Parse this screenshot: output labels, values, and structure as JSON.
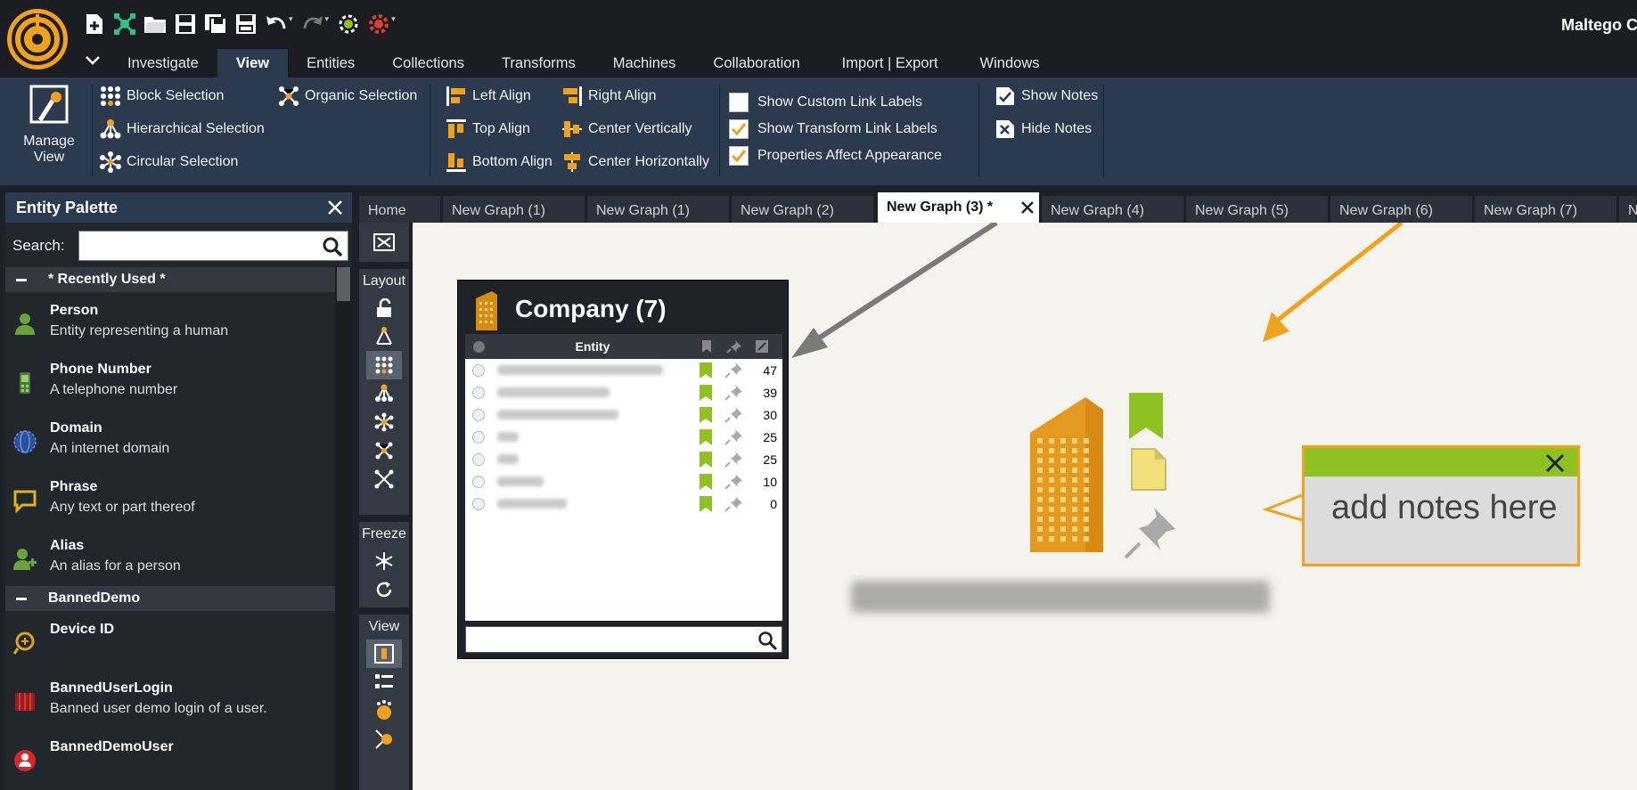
{
  "app": {
    "title": "Maltego C"
  },
  "menu": {
    "tabs": [
      {
        "label": "Investigate"
      },
      {
        "label": "View",
        "active": true
      },
      {
        "label": "Entities"
      },
      {
        "label": "Collections"
      },
      {
        "label": "Transforms"
      },
      {
        "label": "Machines"
      },
      {
        "label": "Collaboration"
      },
      {
        "label": "Import | Export"
      },
      {
        "label": "Windows"
      }
    ]
  },
  "ribbon": {
    "manage_view_label_1": "Manage",
    "manage_view_label_2": "View",
    "block_selection": "Block Selection",
    "hierarchical_selection": "Hierarchical Selection",
    "circular_selection": "Circular Selection",
    "organic_selection": "Organic Selection",
    "left_align": "Left Align",
    "top_align": "Top Align",
    "bottom_align": "Bottom Align",
    "right_align": "Right Align",
    "center_vertically": "Center Vertically",
    "center_horizontally": "Center Horizontally",
    "show_custom_link_labels": {
      "label": "Show Custom Link Labels",
      "checked": false
    },
    "show_transform_link_labels": {
      "label": "Show Transform Link Labels",
      "checked": true
    },
    "properties_affect_appearance": {
      "label": "Properties Affect Appearance",
      "checked": true
    },
    "show_notes": "Show Notes",
    "hide_notes": "Hide Notes"
  },
  "palette": {
    "title": "Entity Palette",
    "search_label": "Search:",
    "search_value": "",
    "sections": [
      {
        "label": "* Recently Used *",
        "items": [
          {
            "name": "Person",
            "desc": "Entity representing a human",
            "icon": "person-icon"
          },
          {
            "name": "Phone Number",
            "desc": "A telephone number",
            "icon": "phone-icon"
          },
          {
            "name": "Domain",
            "desc": "An internet domain",
            "icon": "domain-icon"
          },
          {
            "name": "Phrase",
            "desc": "Any text or part thereof",
            "icon": "phrase-icon"
          },
          {
            "name": "Alias",
            "desc": "An alias for a person",
            "icon": "alias-icon"
          }
        ]
      },
      {
        "label": "BannedDemo",
        "items": [
          {
            "name": "Device ID",
            "desc": "",
            "icon": "device-id-icon"
          },
          {
            "name": "BannedUserLogin",
            "desc": "Banned user demo login of a user.",
            "icon": "banned-login-icon"
          },
          {
            "name": "BannedDemoUser",
            "desc": "",
            "icon": "banned-user-icon"
          }
        ]
      }
    ]
  },
  "graph_tabs": [
    {
      "label": "Home"
    },
    {
      "label": "New Graph (1)"
    },
    {
      "label": "New Graph (1)"
    },
    {
      "label": "New Graph (2)"
    },
    {
      "label": "New Graph (3) *",
      "active": true
    },
    {
      "label": "New Graph (4)"
    },
    {
      "label": "New Graph (5)"
    },
    {
      "label": "New Graph (6)"
    },
    {
      "label": "New Graph (7)"
    },
    {
      "label": "N"
    }
  ],
  "side_toolbar": {
    "layout_label": "Layout",
    "freeze_label": "Freeze",
    "view_label": "View"
  },
  "company_card": {
    "title": "Company (7)",
    "column_entity": "Entity",
    "rows": [
      {
        "count": "47"
      },
      {
        "count": "39"
      },
      {
        "count": "30"
      },
      {
        "count": "25"
      },
      {
        "count": "25"
      },
      {
        "count": "10"
      },
      {
        "count": "0"
      }
    ]
  },
  "note": {
    "text": "add notes here"
  },
  "colors": {
    "accent_orange": "#f0a21e",
    "note_green": "#8dc220",
    "ribbon_blue": "#2b3a4f"
  }
}
